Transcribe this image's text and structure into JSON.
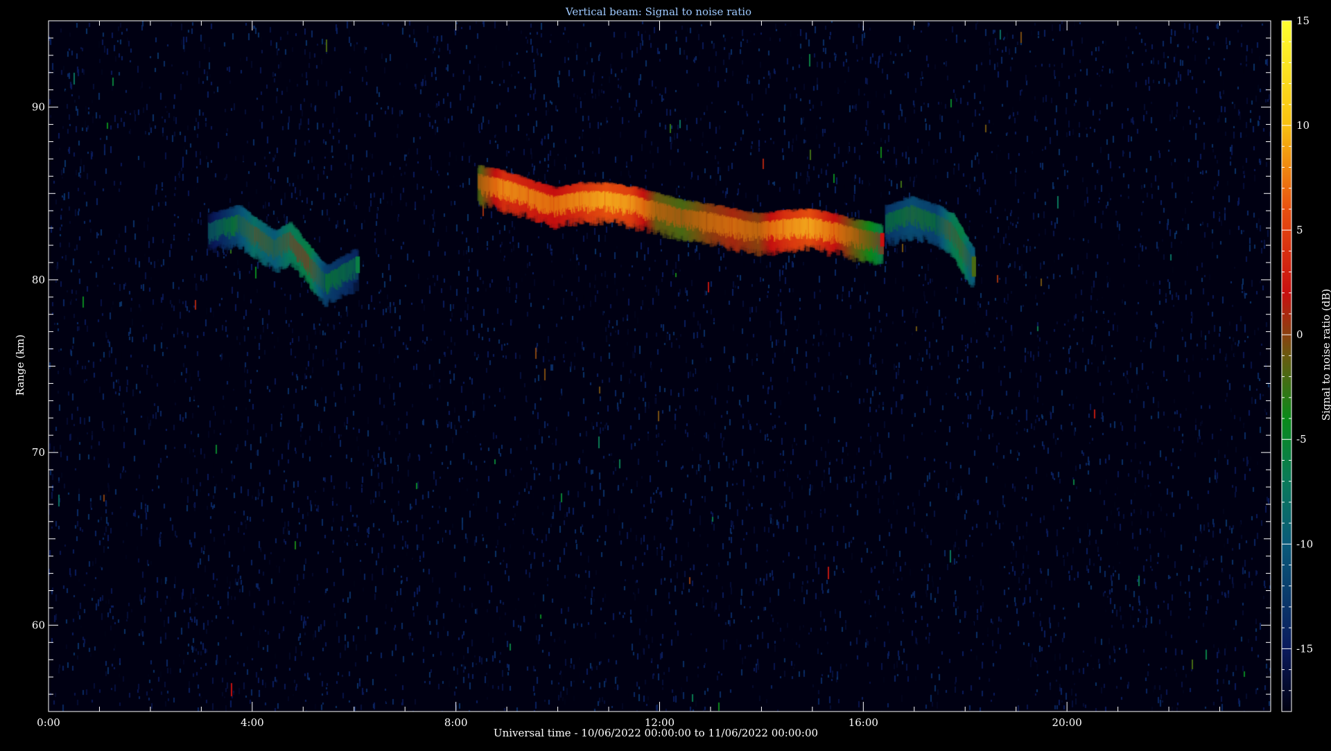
{
  "chart_data": {
    "type": "heatmap",
    "title": "Vertical beam: Signal to noise ratio",
    "xlabel": "Universal time - 10/06/2022 00:00:00 to 11/06/2022 00:00:00",
    "ylabel": "Range (km)",
    "colorbar_label": "Signal to noise ratio (dB)",
    "xlim_hours": [
      0,
      24
    ],
    "ylim_km": [
      55,
      95
    ],
    "clim_db": [
      -18,
      15
    ],
    "x_ticks": [
      {
        "hour": 0,
        "label": "0:00"
      },
      {
        "hour": 4,
        "label": "4:00"
      },
      {
        "hour": 8,
        "label": "8:00"
      },
      {
        "hour": 12,
        "label": "12:00"
      },
      {
        "hour": 16,
        "label": "16:00"
      },
      {
        "hour": 20,
        "label": "20:00"
      }
    ],
    "y_ticks": [
      {
        "km": 60,
        "label": "60"
      },
      {
        "km": 70,
        "label": "70"
      },
      {
        "km": 80,
        "label": "80"
      },
      {
        "km": 90,
        "label": "90"
      }
    ],
    "colorbar_ticks": [
      {
        "db": 15,
        "label": "15"
      },
      {
        "db": 10,
        "label": "10"
      },
      {
        "db": 5,
        "label": "5"
      },
      {
        "db": 0,
        "label": "0"
      },
      {
        "db": -5,
        "label": "-5"
      },
      {
        "db": -10,
        "label": "-10"
      },
      {
        "db": -15,
        "label": "-15"
      }
    ],
    "colormap": [
      {
        "db": -18,
        "color": "#000010"
      },
      {
        "db": -15,
        "color": "#0a1a5c"
      },
      {
        "db": -10,
        "color": "#0a5a7a"
      },
      {
        "db": -7,
        "color": "#0a7a5a"
      },
      {
        "db": -4,
        "color": "#0a8a1a"
      },
      {
        "db": -1,
        "color": "#6a5a10"
      },
      {
        "db": 2,
        "color": "#c81010"
      },
      {
        "db": 6,
        "color": "#e85010"
      },
      {
        "db": 10,
        "color": "#f8c010"
      },
      {
        "db": 15,
        "color": "#ffff30"
      }
    ],
    "echo_layers": [
      {
        "region": "early patch",
        "points": [
          {
            "hour": 3.2,
            "km": 83.0,
            "db": -8
          },
          {
            "hour": 3.8,
            "km": 83.5,
            "db": -3
          },
          {
            "hour": 4.1,
            "km": 82.8,
            "db": 0
          },
          {
            "hour": 4.5,
            "km": 82.0,
            "db": -2
          },
          {
            "hour": 4.8,
            "km": 82.5,
            "db": 1
          },
          {
            "hour": 5.2,
            "km": 81.0,
            "db": 2
          },
          {
            "hour": 5.5,
            "km": 80.0,
            "db": -4
          },
          {
            "hour": 6.1,
            "km": 81.0,
            "db": -6
          }
        ]
      },
      {
        "region": "main layer",
        "points": [
          {
            "hour": 8.5,
            "km": 85.8,
            "db": 6
          },
          {
            "hour": 9.0,
            "km": 85.5,
            "db": 12
          },
          {
            "hour": 9.5,
            "km": 85.0,
            "db": 11
          },
          {
            "hour": 10.0,
            "km": 84.5,
            "db": 10
          },
          {
            "hour": 10.5,
            "km": 84.8,
            "db": 12
          },
          {
            "hour": 11.0,
            "km": 84.8,
            "db": 14
          },
          {
            "hour": 11.5,
            "km": 84.6,
            "db": 13
          },
          {
            "hour": 12.0,
            "km": 84.2,
            "db": 7
          },
          {
            "hour": 12.5,
            "km": 83.8,
            "db": 6
          },
          {
            "hour": 13.0,
            "km": 83.6,
            "db": 8
          },
          {
            "hour": 13.5,
            "km": 83.3,
            "db": 9
          },
          {
            "hour": 14.0,
            "km": 83.0,
            "db": 8
          },
          {
            "hour": 14.5,
            "km": 83.2,
            "db": 12
          },
          {
            "hour": 15.0,
            "km": 83.3,
            "db": 14
          },
          {
            "hour": 15.5,
            "km": 83.0,
            "db": 10
          },
          {
            "hour": 16.0,
            "km": 82.6,
            "db": 6
          },
          {
            "hour": 16.4,
            "km": 82.4,
            "db": 2
          }
        ]
      },
      {
        "region": "late patch",
        "points": [
          {
            "hour": 16.5,
            "km": 83.5,
            "db": -5
          },
          {
            "hour": 17.0,
            "km": 84.0,
            "db": -3
          },
          {
            "hour": 17.5,
            "km": 83.5,
            "db": -4
          },
          {
            "hour": 17.8,
            "km": 83.0,
            "db": 1
          },
          {
            "hour": 18.0,
            "km": 82.0,
            "db": 2
          },
          {
            "hour": 18.2,
            "km": 81.0,
            "db": -2
          }
        ]
      }
    ]
  }
}
